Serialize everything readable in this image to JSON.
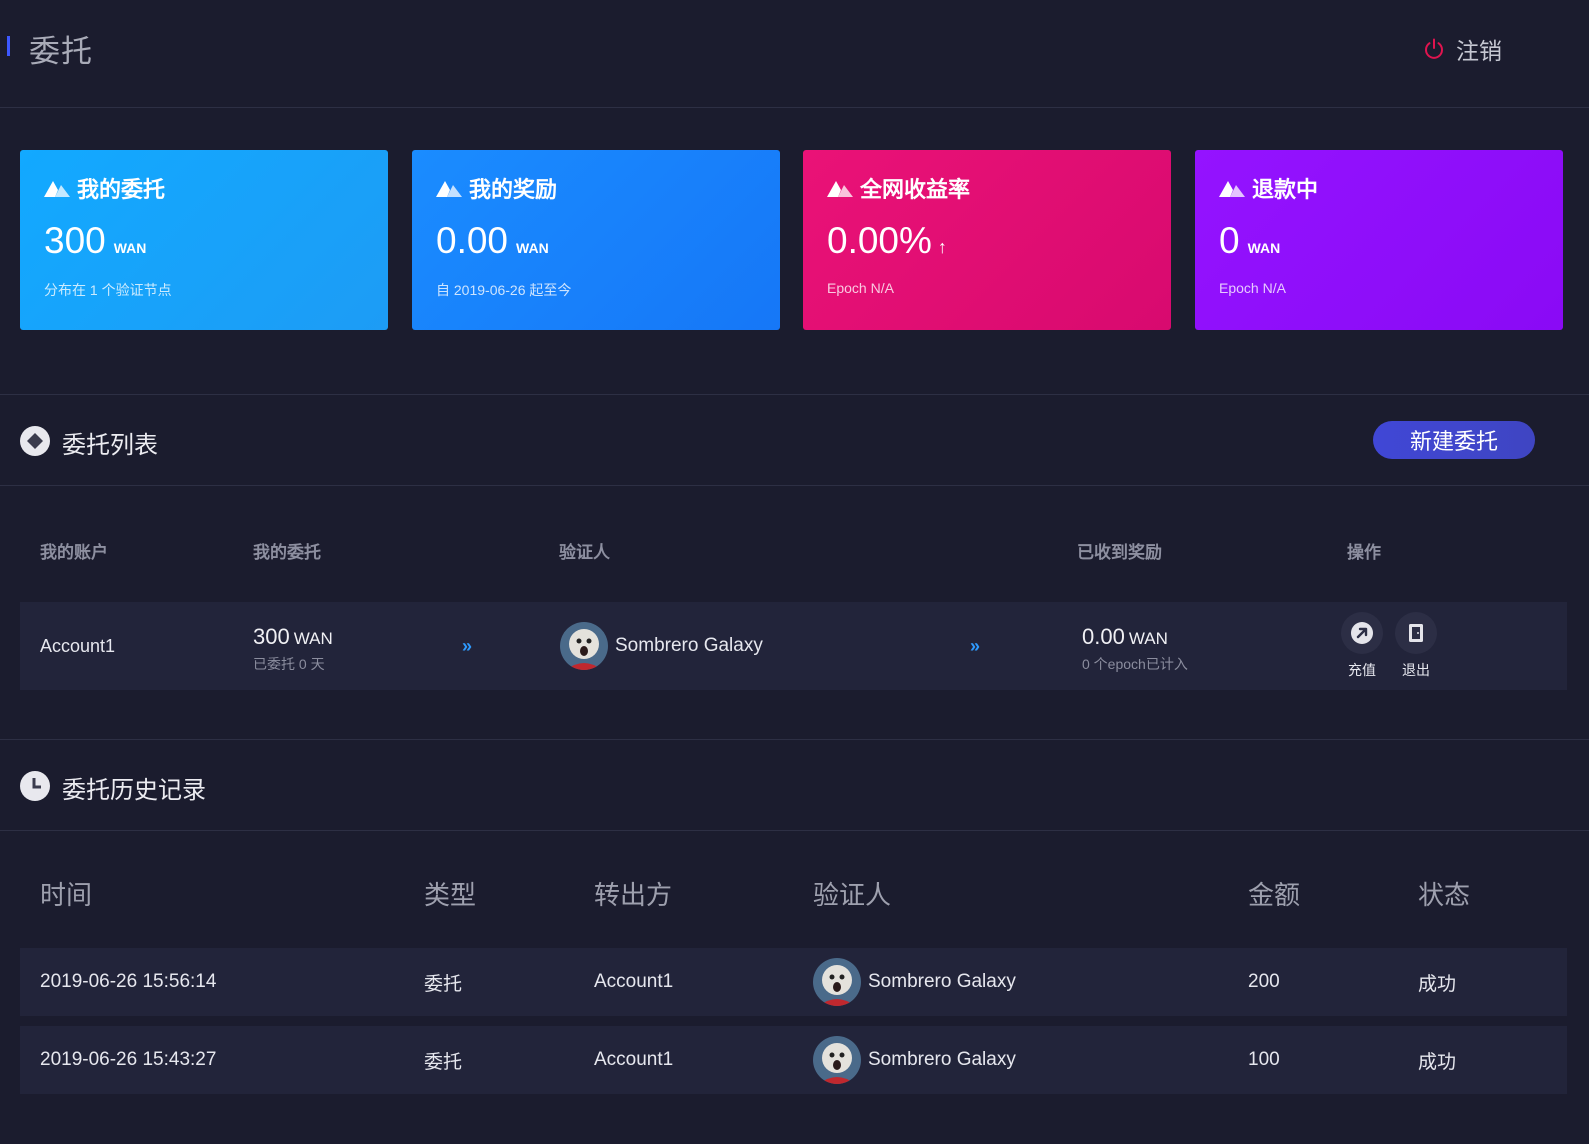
{
  "header": {
    "title": "委托",
    "logout_label": "注销"
  },
  "cards": [
    {
      "title": "我的委托",
      "value": "300",
      "unit": "WAN",
      "arrow": "",
      "sub": "分布在 1 个验证节点"
    },
    {
      "title": "我的奖励",
      "value": "0.00",
      "unit": "WAN",
      "arrow": "",
      "sub": "自 2019-06-26 起至今"
    },
    {
      "title": "全网收益率",
      "value": "0.00%",
      "unit": "",
      "arrow": "↑",
      "sub": "Epoch N/A"
    },
    {
      "title": "退款中",
      "value": "0",
      "unit": "WAN",
      "arrow": "",
      "sub": "Epoch N/A"
    }
  ],
  "delegation_list": {
    "title": "委托列表",
    "new_button": "新建委托",
    "columns": [
      "我的账户",
      "我的委托",
      "验证人",
      "已收到奖励",
      "操作"
    ],
    "rows": [
      {
        "account": "Account1",
        "amount": "300",
        "amount_unit": "WAN",
        "days": "已委托 0 天",
        "chevron": "»",
        "validator": "Sombrero Galaxy",
        "reward": "0.00",
        "reward_unit": "WAN",
        "reward_sub": "0 个epoch已计入",
        "op_topup": "充值",
        "op_exit": "退出"
      }
    ]
  },
  "history": {
    "title": "委托历史记录",
    "columns": [
      "时间",
      "类型",
      "转出方",
      "验证人",
      "金额",
      "状态"
    ],
    "rows": [
      {
        "time": "2019-06-26 15:56:14",
        "type": "委托",
        "from": "Account1",
        "validator": "Sombrero Galaxy",
        "amount": "200",
        "status": "成功"
      },
      {
        "time": "2019-06-26 15:43:27",
        "type": "委托",
        "from": "Account1",
        "validator": "Sombrero Galaxy",
        "amount": "100",
        "status": "成功"
      }
    ]
  },
  "colors": {
    "background": "#1b1c2e",
    "card_1": "#12a9ff",
    "card_2": "#1a8cff",
    "card_3": "#ea1277",
    "card_4": "#9413ff",
    "primary_button": "#4047d6",
    "logout_icon": "#e0144f"
  },
  "icons": {
    "card": "mountain-icon",
    "logout": "power-icon",
    "list_section": "diamond-icon",
    "history_section": "clock-icon",
    "topup": "arrow-up-right-icon",
    "exit": "door-exit-icon"
  }
}
